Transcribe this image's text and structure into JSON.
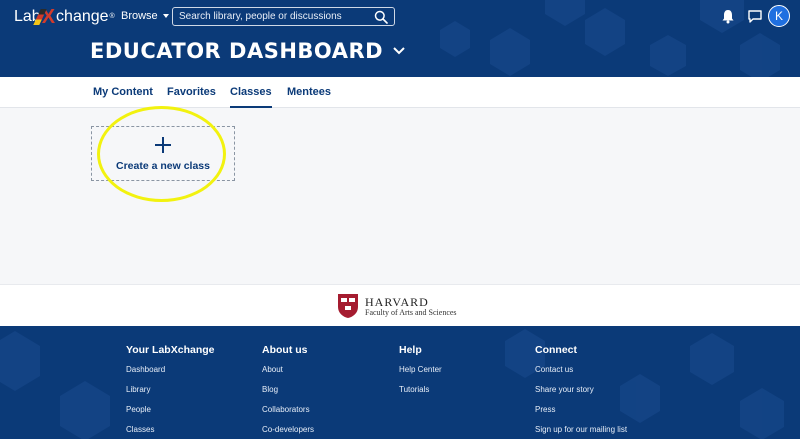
{
  "header": {
    "logo_text_left": "Lab",
    "logo_x": "X",
    "logo_text_right": "change",
    "logo_tm": "®",
    "browse_label": "Browse",
    "search_placeholder": "Search library, people or discussions",
    "avatar_initial": "K",
    "dashboard_title": "EDUCATOR DASHBOARD"
  },
  "tabs": [
    {
      "label": "My Content",
      "active": false
    },
    {
      "label": "Favorites",
      "active": false
    },
    {
      "label": "Classes",
      "active": true
    },
    {
      "label": "Mentees",
      "active": false
    }
  ],
  "main": {
    "create_class_label": "Create a new class"
  },
  "harvard": {
    "name": "HARVARD",
    "faculty": "Faculty of Arts and Sciences"
  },
  "footer": {
    "columns": [
      {
        "title": "Your LabXchange",
        "links": [
          "Dashboard",
          "Library",
          "People",
          "Classes"
        ]
      },
      {
        "title": "About us",
        "links": [
          "About",
          "Blog",
          "Collaborators",
          "Co-developers"
        ]
      },
      {
        "title": "Help",
        "links": [
          "Help Center",
          "Tutorials"
        ]
      },
      {
        "title": "Connect",
        "links": [
          "Contact us",
          "Share your story",
          "Press",
          "Sign up for our mailing list"
        ]
      }
    ]
  },
  "colors": {
    "brand_navy": "#0b3a78",
    "logo_red": "#d23b2c",
    "highlight_yellow": "#f2f20f",
    "avatar_blue": "#1f6fe0"
  }
}
